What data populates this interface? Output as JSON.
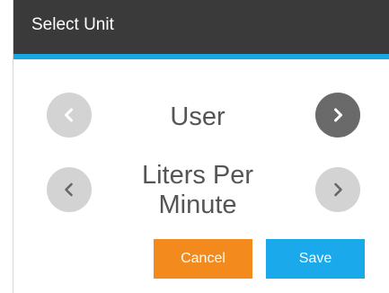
{
  "dialog": {
    "title": "Select Unit",
    "colors": {
      "titlebar": "#3a3a3a",
      "accent": "#17a8e3"
    }
  },
  "row1": {
    "value": "User",
    "prev_icon": "chevron-left-icon",
    "next_icon": "chevron-right-icon"
  },
  "row2": {
    "value_line1": "Liters Per",
    "value_line2": "Minute",
    "prev_icon": "chevron-left-icon",
    "next_icon": "chevron-right-icon"
  },
  "buttons": {
    "cancel_label": "Cancel",
    "save_label": "Save",
    "cancel_color": "#f28a1e",
    "save_color": "#1aa9ea"
  }
}
